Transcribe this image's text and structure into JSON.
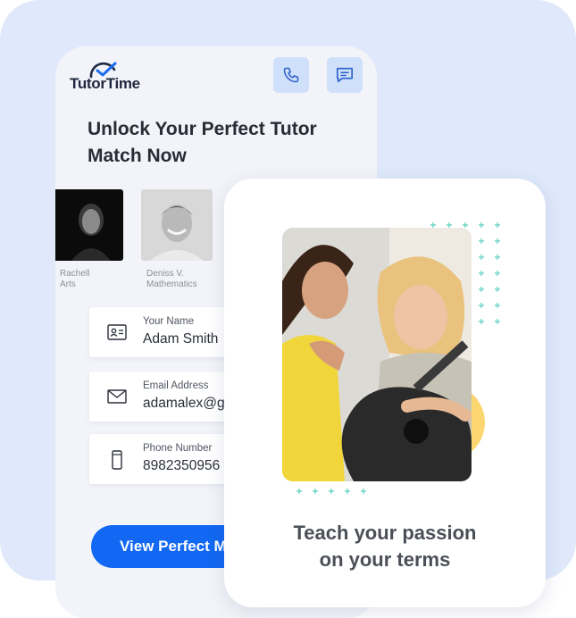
{
  "app": {
    "logo_text": "TutorTime"
  },
  "icons": {
    "logo": "check-arc-icon",
    "call": "phone-icon",
    "chat": "chat-icon",
    "name": "id-card-icon",
    "email": "envelope-icon",
    "phone": "mobile-icon"
  },
  "hero": {
    "headline": "Unlock Your Perfect Tutor Match Now"
  },
  "tutors": [
    {
      "name": "Rachell",
      "subject": "Arts"
    },
    {
      "name": "Deniss V.",
      "subject": "Mathematics"
    }
  ],
  "form": {
    "name_label": "Your Name",
    "name_value": "Adam Smith",
    "email_label": "Email Address",
    "email_value": "adamalex@gm",
    "phone_label": "Phone Number",
    "phone_value": "8982350956",
    "cta_label": "View Perfect Matches"
  },
  "card": {
    "tagline_line1": "Teach your passion",
    "tagline_line2": "on your terms"
  },
  "colors": {
    "background": "#dfe9fb",
    "primary": "#1268f2",
    "icon_button_bg": "#cfe0fb",
    "accent_dots": "#6fd4c3",
    "accent_yellow": "#fbd671"
  }
}
